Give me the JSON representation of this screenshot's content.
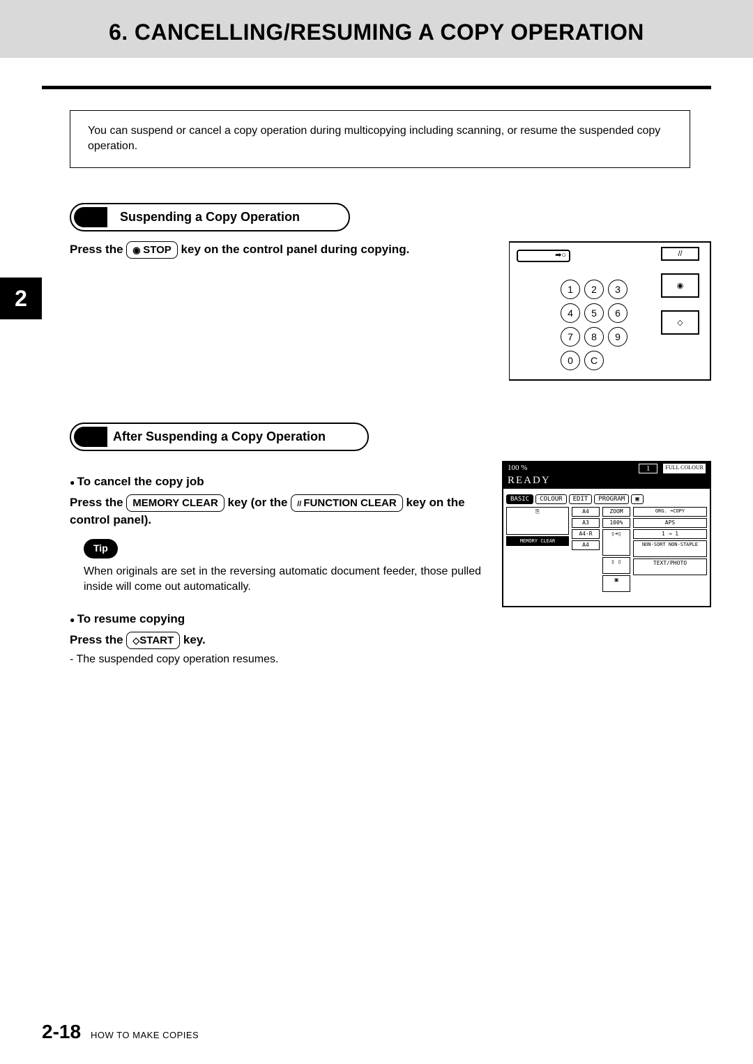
{
  "header": {
    "title": "6. CANCELLING/RESUMING A COPY OPERATION"
  },
  "intro": "You can suspend or cancel a copy operation during multicopying including scanning, or resume the suspended copy operation.",
  "side_chapter": "2",
  "section1": {
    "heading": "Suspending a Copy Operation",
    "line_pre": "Press the ",
    "key_stop": "STOP",
    "line_post": " key on the control panel during copying."
  },
  "keypad": {
    "r1": [
      "1",
      "2",
      "3"
    ],
    "r2": [
      "4",
      "5",
      "6"
    ],
    "r3": [
      "7",
      "8",
      "9"
    ],
    "r4": [
      "0",
      "C"
    ]
  },
  "right_btns": {
    "b1": "//",
    "b2": "◉",
    "b3": "◇"
  },
  "section2": {
    "heading": "After Suspending a Copy Operation",
    "cancel_head": "To cancel the copy job",
    "cancel_pre": "Press the ",
    "key_memclear": "MEMORY CLEAR",
    "cancel_mid1": " key (or the ",
    "key_funcclear": "FUNCTION CLEAR",
    "cancel_mid2": " key on the control panel).",
    "tip_label": "Tip",
    "tip_text": "When originals are set in the reversing automatic document feeder, those pulled inside will come out automatically.",
    "resume_head": "To resume copying",
    "resume_pre": "Press the ",
    "key_start": "START",
    "resume_post": " key.",
    "resume_note": "- The suspended copy operation resumes."
  },
  "lcd": {
    "percent": "100 %",
    "count": "1",
    "mode": "FULL COLOUR",
    "ready": "READY",
    "tabs": [
      "BASIC",
      "COLOUR",
      "EDIT",
      "PROGRAM",
      "▣"
    ],
    "zoom_label": "ZOOM",
    "zoom_val": "100%",
    "org_label": "ORG. ➜COPY",
    "aps": "APS",
    "dup": "1 → 1",
    "sort": "NON-SORT NON-STAPLE",
    "text": "TEXT/PHOTO",
    "trays": [
      "A4",
      "A3",
      "A4-R",
      "A4"
    ],
    "memclear": "MEMORY CLEAR"
  },
  "footer": {
    "page": "2-18",
    "chapter": "HOW TO MAKE COPIES"
  }
}
